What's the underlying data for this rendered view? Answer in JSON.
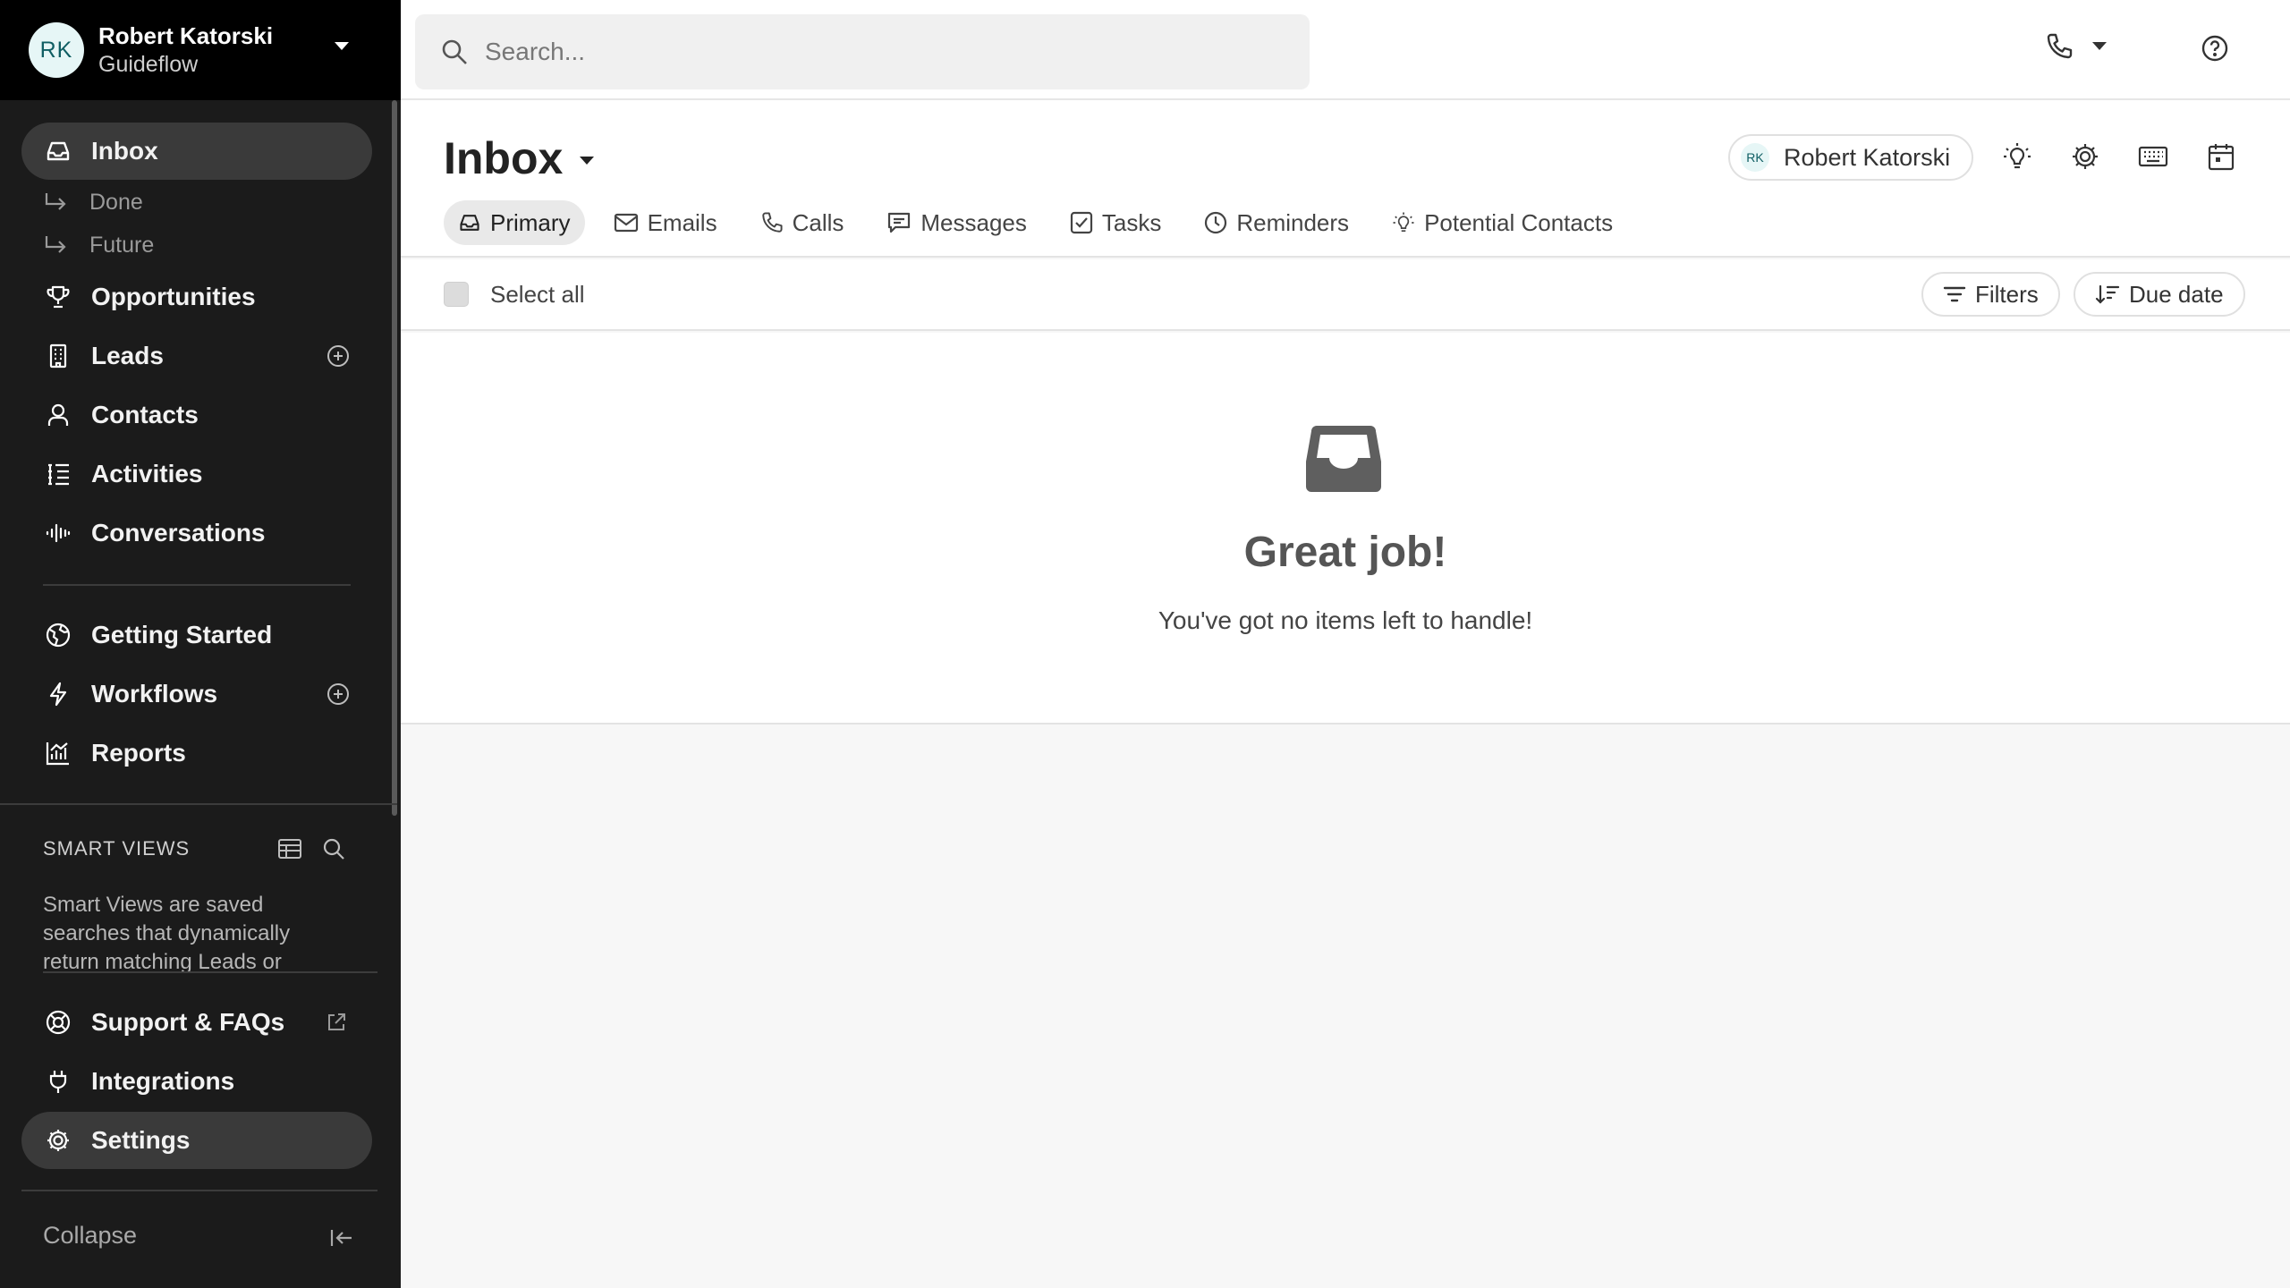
{
  "account": {
    "initials": "RK",
    "name": "Robert Katorski",
    "org": "Guideflow"
  },
  "sidebar": {
    "inbox": "Inbox",
    "done": "Done",
    "future": "Future",
    "opportunities": "Opportunities",
    "leads": "Leads",
    "contacts": "Contacts",
    "activities": "Activities",
    "conversations": "Conversations",
    "getting_started": "Getting Started",
    "workflows": "Workflows",
    "reports": "Reports",
    "smart_views_heading": "SMART VIEWS",
    "smart_views_desc": "Smart Views are saved searches that dynamically return matching Leads or Contacts.",
    "support": "Support & FAQs",
    "integrations": "Integrations",
    "settings": "Settings",
    "collapse": "Collapse"
  },
  "search": {
    "placeholder": "Search..."
  },
  "header": {
    "title": "Inbox",
    "owner_initials": "RK",
    "owner_name": "Robert Katorski",
    "tabs": {
      "primary": "Primary",
      "emails": "Emails",
      "calls": "Calls",
      "messages": "Messages",
      "tasks": "Tasks",
      "reminders": "Reminders",
      "potential_contacts": "Potential Contacts"
    }
  },
  "toolbar": {
    "select_all": "Select all",
    "filters": "Filters",
    "sort": "Due date"
  },
  "empty_state": {
    "title": "Great job!",
    "subtitle": "You've got no items left to handle!"
  },
  "colors": {
    "sidebar_bg": "#1b1b1b",
    "account_bg": "#000000",
    "active_item": "#3a3a3a",
    "avatar_bg": "#e6f6f6",
    "avatar_text": "#0f5e63"
  }
}
